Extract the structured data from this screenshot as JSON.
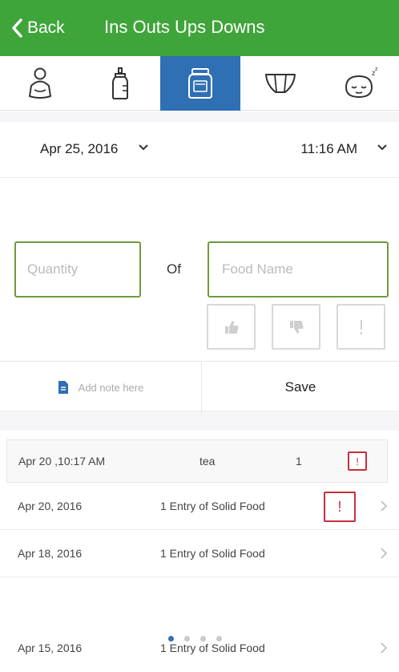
{
  "header": {
    "back_label": "Back",
    "title": "Ins Outs Ups Downs",
    "color": "#3fa53a"
  },
  "tabs": [
    {
      "icon": "baby-bottle-bag-icon",
      "active": false
    },
    {
      "icon": "baby-bottle-icon",
      "active": false
    },
    {
      "icon": "food-jar-icon",
      "active": true
    },
    {
      "icon": "diaper-icon",
      "active": false
    },
    {
      "icon": "sleeping-baby-icon",
      "active": false
    }
  ],
  "form": {
    "date": "Apr 25, 2016",
    "time": "11:16 AM",
    "quantity_placeholder": "Quantity",
    "of_label": "Of",
    "food_placeholder": "Food Name",
    "note_label": "Add note here",
    "save_label": "Save"
  },
  "latest_entry": {
    "datetime": "Apr 20 ,10:17 AM",
    "food": "tea",
    "quantity": "1",
    "alert": "!"
  },
  "history": [
    {
      "date": "Apr 20, 2016",
      "summary": "1 Entry of Solid Food",
      "alert": "!"
    },
    {
      "date": "Apr 18, 2016",
      "summary": "1 Entry of Solid Food"
    },
    {
      "date": "Apr 15, 2016",
      "summary": "1 Entry of Solid Food"
    }
  ],
  "pager": {
    "pages": 4,
    "current": 1
  },
  "colors": {
    "accent": "#2f6fb3",
    "alert": "#c62f3d",
    "input_border": "#6f9a3c"
  }
}
